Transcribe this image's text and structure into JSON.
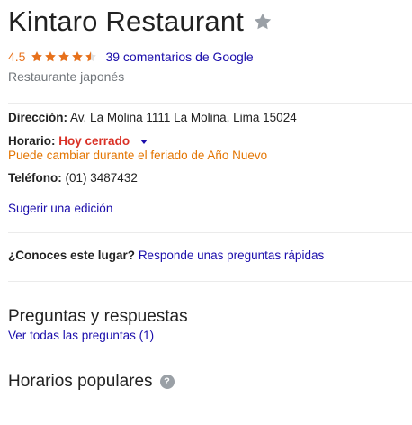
{
  "business": {
    "name": "Kintaro Restaurant",
    "rating": "4.5",
    "rating_value": 4.5,
    "rating_max": 5,
    "reviews_link": "39 comentarios de Google",
    "category": "Restaurante japonés"
  },
  "info": {
    "address_label": "Dirección:",
    "address_value": "Av. La Molina 1111 La Molina, Lima 15024",
    "hours_label": "Horario:",
    "hours_status": "Hoy cerrado",
    "holiday_note": "Puede cambiar durante el feriado de Año Nuevo",
    "phone_label": "Teléfono:",
    "phone_value": "(01) 3487432",
    "suggest_edit": "Sugerir una edición"
  },
  "know_place": {
    "question": "¿Conoces este lugar?",
    "link": "Responde unas preguntas rápidas"
  },
  "qa": {
    "title": "Preguntas y respuestas",
    "link": "Ver todas las preguntas (1)"
  },
  "popular_times": {
    "title": "Horarios populares",
    "help_icon_char": "?"
  },
  "colors": {
    "star": "#e7711b",
    "link": "#1a0dab",
    "closed": "#d93025",
    "holiday": "#e37400",
    "save_star": "#9aa0a6"
  },
  "icons": {
    "save": "star-outline-icon",
    "rating": "star-icon",
    "hours_dropdown": "caret-down-icon",
    "help": "help-circle-icon"
  }
}
